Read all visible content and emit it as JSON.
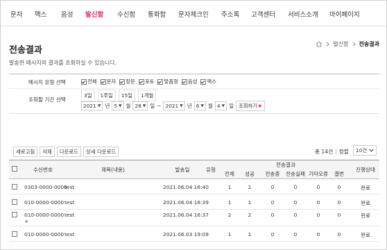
{
  "nav": {
    "items": [
      "문자",
      "팩스",
      "음성",
      "발신함",
      "수신함",
      "통화함",
      "문자체크인",
      "주소록",
      "고객센터",
      "서비스소개",
      "마이페이지"
    ],
    "active_index": 3
  },
  "page": {
    "title": "전송결과",
    "breadcrumb": [
      "발신함",
      "전송결과"
    ],
    "description": "발송한 메시지의 결과를 조회하실 수 있습니다."
  },
  "filter": {
    "type_label": "메시지 유형 선택",
    "types": [
      "전체",
      "문자",
      "장문",
      "포토",
      "맞춤형",
      "음성",
      "팩스"
    ],
    "period_label": "조회할 기간 선택",
    "period_buttons": [
      "3일",
      "1주일",
      "15일",
      "1개월"
    ],
    "from": {
      "year": "2021",
      "month": "5",
      "day": "28"
    },
    "to": {
      "year": "2021",
      "month": "6",
      "day": "4"
    },
    "unit_year": "년",
    "unit_month": "월",
    "unit_day": "일",
    "tilde": "~",
    "search_button": "조회하기"
  },
  "toolbar": {
    "refresh": "새로고침",
    "delete": "삭제",
    "download": "다운로드",
    "detail_download": "상세 다운로드",
    "total_text": "총 14건",
    "sort_text": "정렬",
    "page_size": "10건"
  },
  "table": {
    "headers": {
      "receiver": "수신번호",
      "title": "제목(내용)",
      "date": "발송일",
      "type": "유형",
      "result_group": "전송결과",
      "total": "전체",
      "success": "성공",
      "sending": "전송중",
      "fail": "전송실패",
      "other": "기타오류",
      "missed": "결번",
      "status": "진행상태"
    },
    "rows": [
      {
        "receiver": "0303-0000-0000",
        "title": "test",
        "date": "2021.06.04 16:40",
        "type": "",
        "total": "1",
        "success": "1",
        "sending": "0",
        "fail": "0",
        "other": "0",
        "missed": "0",
        "status": "완료"
      },
      {
        "receiver": "010-0000-0000",
        "title": "test",
        "date": "2021.06.04 16:39",
        "type": "",
        "total": "1",
        "success": "1",
        "sending": "0",
        "fail": "0",
        "other": "0",
        "missed": "0",
        "status": "완료"
      },
      {
        "receiver": "010-0000-0000",
        "receiver_extra": "+",
        "title": "test",
        "date": "2021.06.04 16:37",
        "type": "",
        "total": "2",
        "success": "2",
        "sending": "0",
        "fail": "0",
        "other": "0",
        "missed": "0",
        "status": "완료"
      },
      {
        "receiver": "010-0000-0000",
        "title": "test",
        "date": "2021.06.03 19:09",
        "type": "",
        "total": "1",
        "success": "1",
        "sending": "0",
        "fail": "0",
        "other": "0",
        "missed": "0",
        "status": "완료"
      }
    ]
  },
  "colors": {
    "accent": "#e0266d"
  },
  "icons": {
    "home": "home-icon",
    "chevron": "chevron-right-icon",
    "dropdown": "chevron-down-icon"
  }
}
